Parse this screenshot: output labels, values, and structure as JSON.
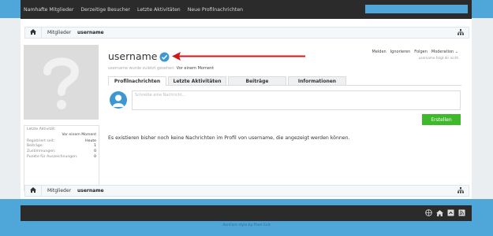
{
  "topnav": {
    "links": [
      "Namhafte Mitglieder",
      "Derzeitige Besucher",
      "Letzte Aktivitäten",
      "Neue Profilnachrichten"
    ]
  },
  "breadcrumb": {
    "items": [
      "Mitglieder",
      "username"
    ]
  },
  "profile": {
    "username": "username",
    "actions": [
      "Melden",
      "Ignorieren",
      "Folgen",
      "Moderation"
    ],
    "follows_text": "username folgt dir nicht",
    "last_seen_prefix": "username wurde zuletzt gesehen:",
    "last_seen_value": "Vor einem Moment"
  },
  "sidebar": {
    "last_activity_label": "Letzte Aktivität:",
    "last_activity_value": "Vor einem Moment",
    "stats": [
      {
        "label": "Registriert seit:",
        "value": "Heute"
      },
      {
        "label": "Beiträge:",
        "value": "1"
      },
      {
        "label": "Zustimmungen:",
        "value": "0"
      },
      {
        "label": "Punkte für Auszeichnungen:",
        "value": "0"
      }
    ]
  },
  "tabs": [
    "Profilnachrichten",
    "Letzte Aktivitäten",
    "Beiträge",
    "Informationen"
  ],
  "post": {
    "placeholder": "Schreibe eine Nachricht...",
    "button": "Erstellen"
  },
  "empty_message": "Es existieren bisher noch keine Nachrichten im Profil von username, die angezeigt werden können.",
  "footer": {
    "credit": "XenForo style by Pixel Exit"
  },
  "colors": {
    "background": "#4ea6d9",
    "dark_bar": "#2b2b2b",
    "accent_blue": "#3d97d3",
    "green_button": "#3fb92b",
    "arrow_red": "#cc1a1a"
  }
}
